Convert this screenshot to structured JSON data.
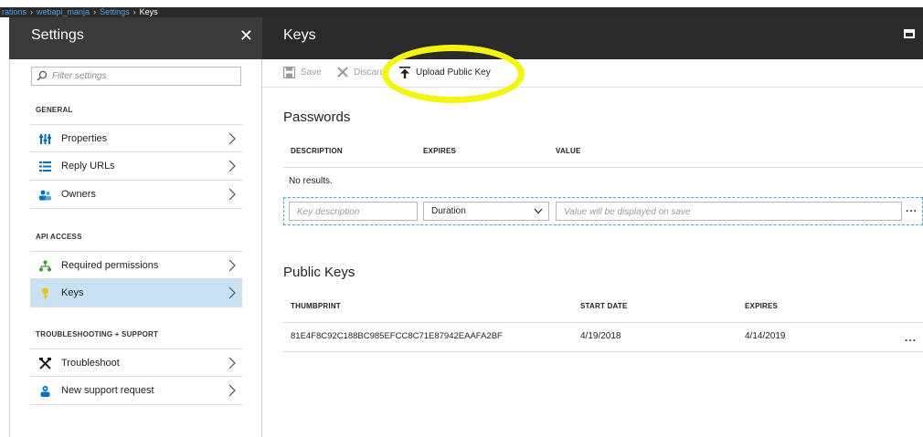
{
  "breadcrumb": {
    "items": [
      "rations",
      "webapi_manja",
      "Settings"
    ],
    "current": "Keys"
  },
  "settings_blade": {
    "title": "Settings",
    "close_glyph": "✕",
    "filter_placeholder": "Filter settings",
    "sections": [
      {
        "label": "GENERAL",
        "items": [
          {
            "label": "Properties",
            "icon": "properties-icon"
          },
          {
            "label": "Reply URLs",
            "icon": "reply-urls-icon"
          },
          {
            "label": "Owners",
            "icon": "owners-icon"
          }
        ]
      },
      {
        "label": "API ACCESS",
        "items": [
          {
            "label": "Required permissions",
            "icon": "permissions-icon"
          },
          {
            "label": "Keys",
            "icon": "key-icon",
            "selected": true
          }
        ]
      },
      {
        "label": "TROUBLESHOOTING + SUPPORT",
        "items": [
          {
            "label": "Troubleshoot",
            "icon": "troubleshoot-icon"
          },
          {
            "label": "New support request",
            "icon": "support-icon"
          }
        ]
      }
    ]
  },
  "keys_blade": {
    "title": "Keys",
    "toolbar": {
      "save_label": "Save",
      "discard_label": "Discard",
      "upload_label": "Upload Public Key"
    },
    "passwords": {
      "heading": "Passwords",
      "columns": [
        "DESCRIPTION",
        "EXPIRES",
        "VALUE"
      ],
      "empty_text": "No results.",
      "new_row": {
        "description_placeholder": "Key description",
        "duration_value": "Duration",
        "value_placeholder": "Value will be displayed on save",
        "more": "..."
      }
    },
    "public_keys": {
      "heading": "Public Keys",
      "columns": [
        "THUMBPRINT",
        "START DATE",
        "EXPIRES"
      ],
      "rows": [
        {
          "thumbprint": "81E4F8C92C188BC985EFCC8C71E87942EAAFA2BF",
          "start_date": "4/19/2018",
          "expires": "4/14/2019",
          "more": "..."
        }
      ]
    }
  },
  "colors": {
    "header_dark": "#2b2b2b",
    "selected_bg": "#c9e2f3",
    "accent_blue": "#0072c6",
    "highlight_yellow": "#f4f40d"
  }
}
